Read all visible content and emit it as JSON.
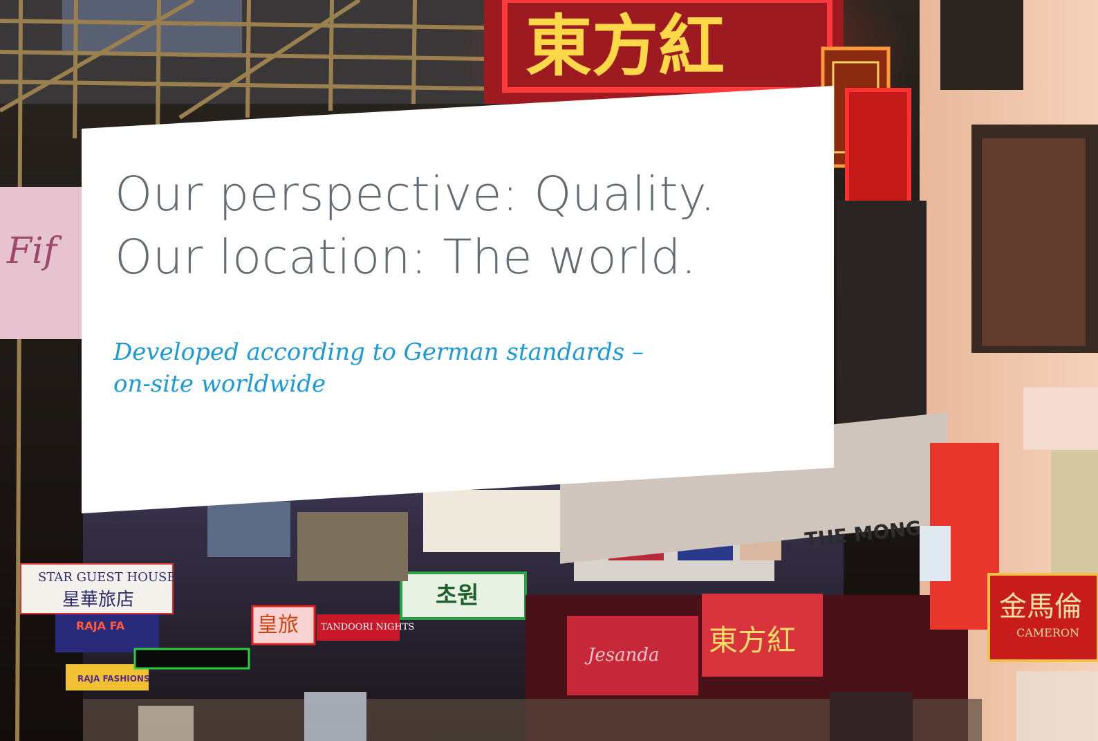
{
  "headline": {
    "line1": "Our perspective: Quality.",
    "line2": "Our location: The world."
  },
  "subline": {
    "line1": "Developed according to German standards –",
    "line2": "on-site worldwide"
  },
  "signs": {
    "star_guest_house": "STAR GUEST HOUSE",
    "star_guest_house_cn": "星華旅店",
    "tandoori_nights": "TANDOORI NIGHTS",
    "raja_fa": "RAJA FA",
    "raja_fashions": "RAJA FASHIONS",
    "the_mong": "THE MONG",
    "cameron": "CAMERON",
    "cameron_cn": "金馬倫",
    "korean_cho_won": "초원",
    "neon_dongfang": "東方紅",
    "banner_dongfang": "東方紅",
    "jesanda": "Jesanda",
    "hotel_cn": "皇旅"
  },
  "colors": {
    "headline_text": "#646c73",
    "subline_text": "#1a9ad9",
    "card_background": "#ffffff"
  }
}
